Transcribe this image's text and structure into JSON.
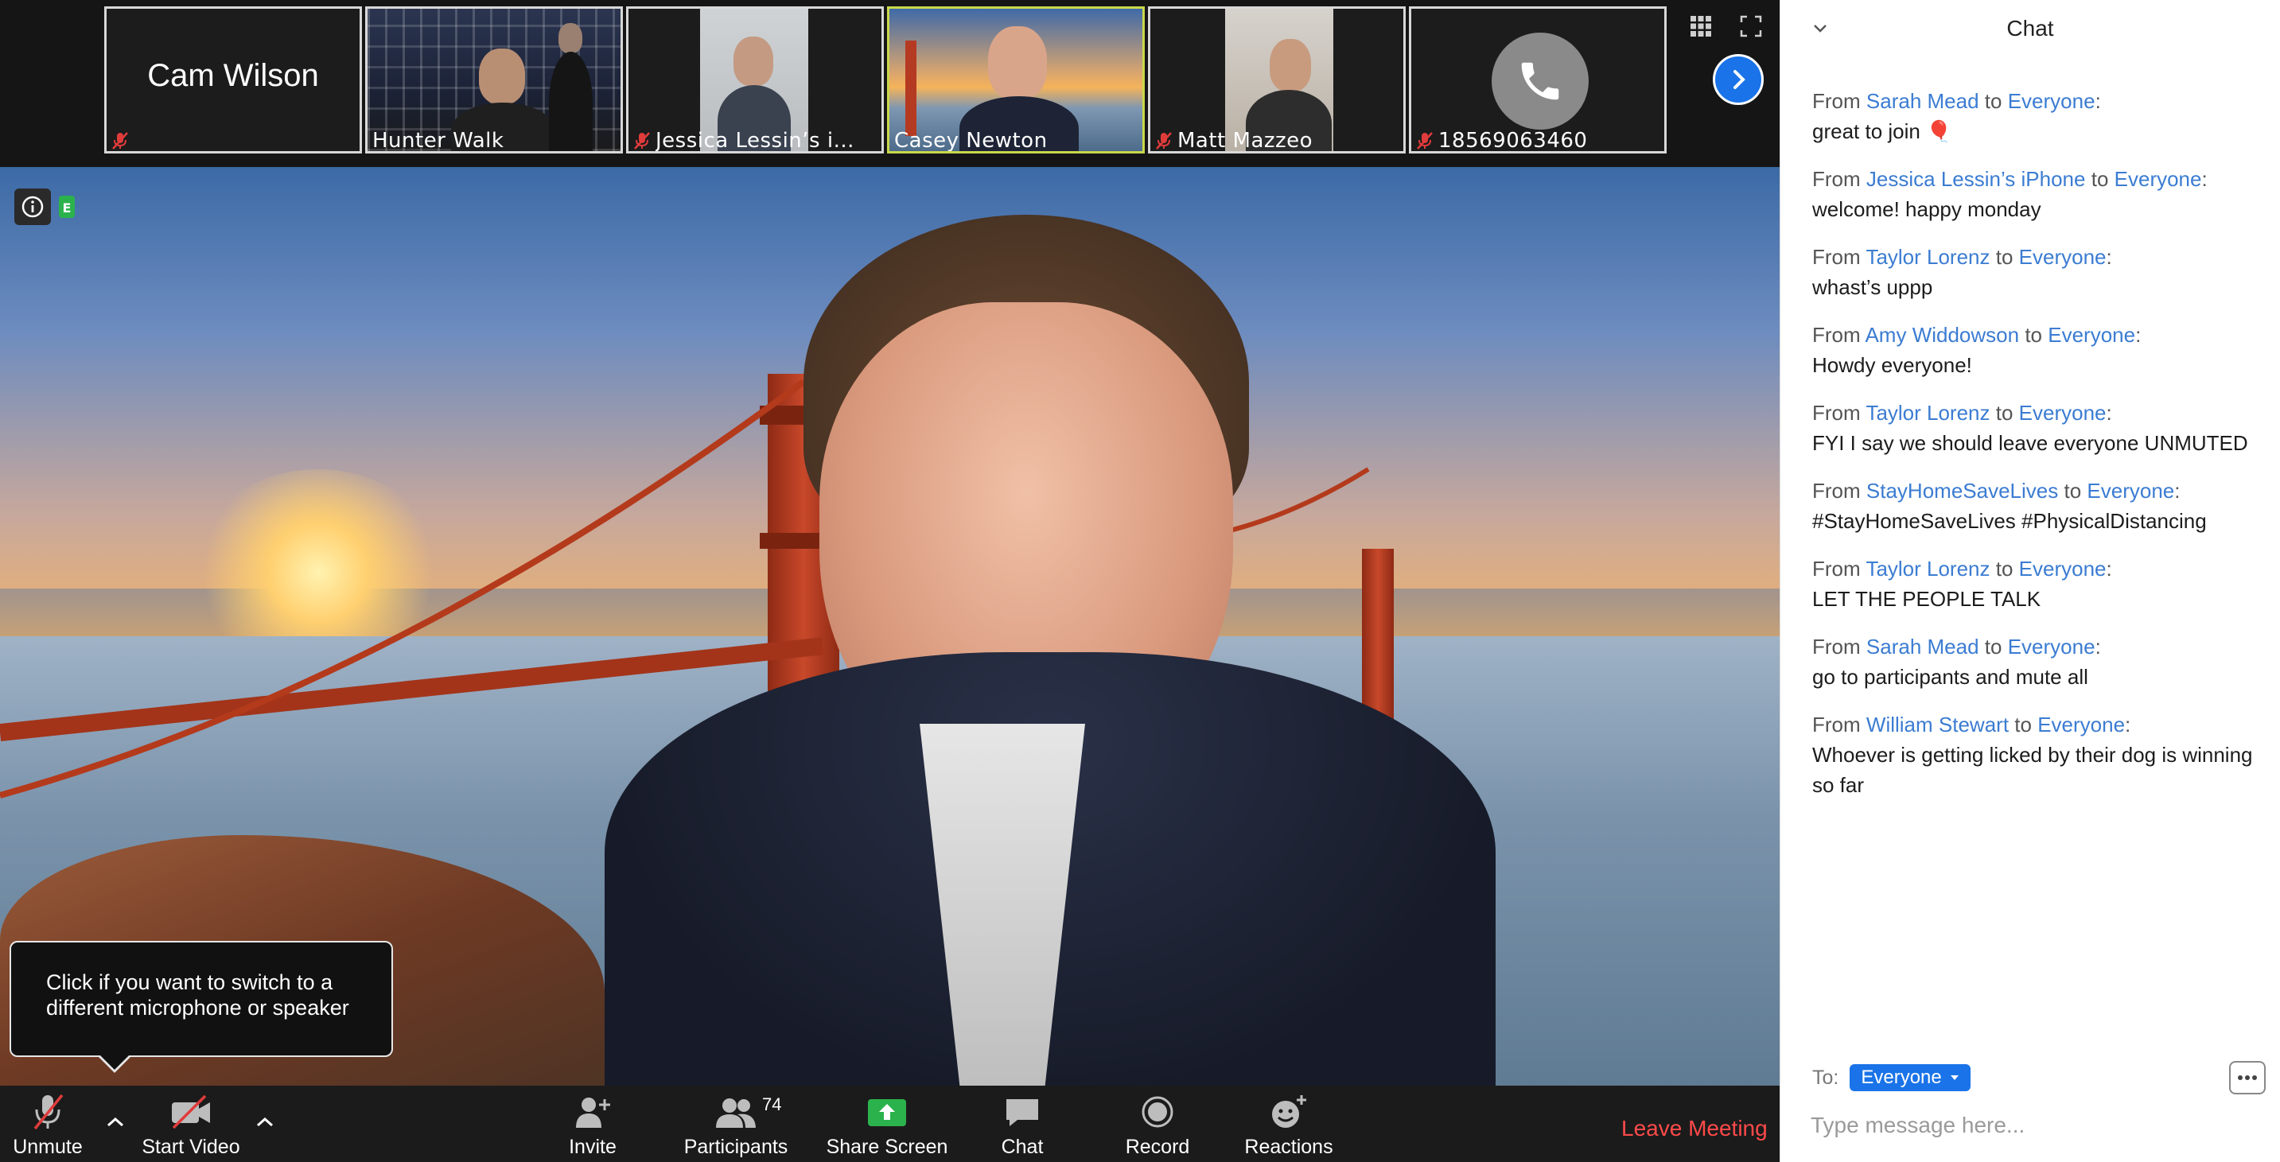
{
  "thumbnails": [
    {
      "name": "Cam Wilson",
      "muted": true,
      "video": false
    },
    {
      "name": "Hunter Walk",
      "muted": false,
      "video": true
    },
    {
      "name": "Jessica Lessin’s i...",
      "muted": true,
      "video": true
    },
    {
      "name": "Casey Newton",
      "muted": false,
      "video": true,
      "active": true
    },
    {
      "name": "Matt Mazzeo",
      "muted": true,
      "video": true
    },
    {
      "name": "18569063460",
      "muted": true,
      "video": false,
      "phone": true
    }
  ],
  "tooltip": {
    "text": "Click if you want to switch to a different microphone or speaker"
  },
  "toolbar": {
    "unmute_label": "Unmute",
    "start_video_label": "Start Video",
    "invite_label": "Invite",
    "participants_label": "Participants",
    "participants_count": "74",
    "share_screen_label": "Share Screen",
    "chat_label": "Chat",
    "record_label": "Record",
    "reactions_label": "Reactions",
    "leave_label": "Leave Meeting"
  },
  "chat": {
    "title": "Chat",
    "messages": [
      {
        "sender": "Sarah Mead",
        "to": "Everyone",
        "text": "great to join 🎈"
      },
      {
        "sender": "Jessica Lessin’s iPhone",
        "to": "Everyone",
        "text": "welcome! happy monday"
      },
      {
        "sender": "Taylor Lorenz",
        "to": "Everyone",
        "text": "whast’s uppp"
      },
      {
        "sender": "Amy Widdowson",
        "to": "Everyone",
        "text": "Howdy everyone!"
      },
      {
        "sender": "Taylor Lorenz",
        "to": "Everyone",
        "text": "FYI I say we should leave everyone UNMUTED"
      },
      {
        "sender": "StayHomeSaveLives",
        "to": "Everyone",
        "text": "#StayHomeSaveLives #PhysicalDistancing"
      },
      {
        "sender": "Taylor Lorenz",
        "to": "Everyone",
        "text": "LET THE PEOPLE TALK"
      },
      {
        "sender": "Sarah Mead",
        "to": "Everyone",
        "text": "go to participants and mute all"
      },
      {
        "sender": "William Stewart",
        "to": "Everyone",
        "text": "Whoever is getting licked by their dog is winning so far"
      }
    ],
    "from_word": "From",
    "to_word": "to",
    "to_label": "To:",
    "to_value": "Everyone",
    "input_placeholder": "Type message here..."
  },
  "colors": {
    "accent": "#1a73e8",
    "link": "#3b7cd2",
    "leave": "#ff4a4a",
    "active_border": "#c9d84a",
    "muted_mic": "#e03b3b",
    "share_green": "#2bb24c"
  }
}
